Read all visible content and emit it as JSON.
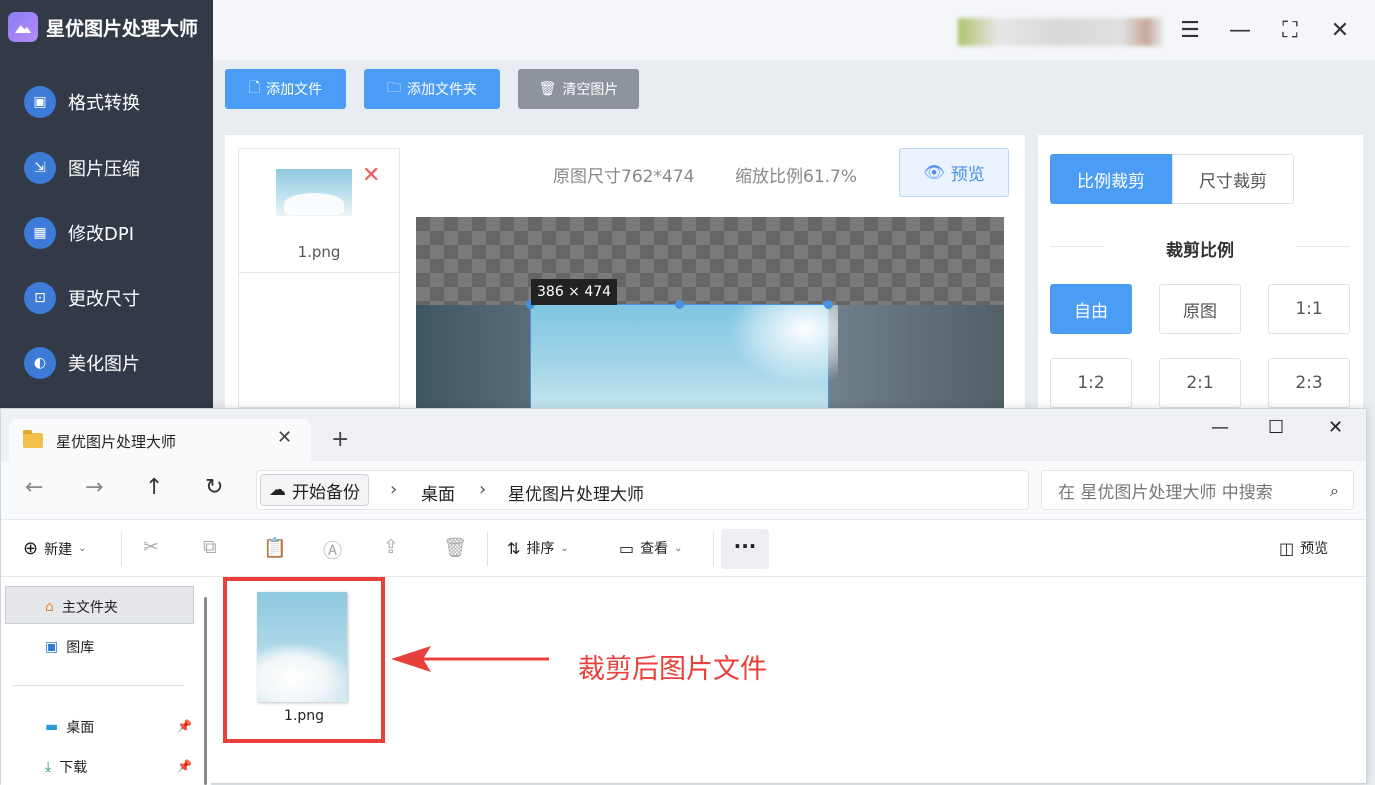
{
  "app": {
    "title": "星优图片处理大师"
  },
  "sidebar": {
    "items": [
      {
        "label": "格式转换",
        "icon": "format-convert-icon"
      },
      {
        "label": "图片压缩",
        "icon": "compress-icon"
      },
      {
        "label": "修改DPI",
        "icon": "dpi-icon"
      },
      {
        "label": "更改尺寸",
        "icon": "resize-icon"
      },
      {
        "label": "美化图片",
        "icon": "beautify-icon"
      }
    ]
  },
  "toolbar": {
    "add_file": "添加文件",
    "add_folder": "添加文件夹",
    "clear": "清空图片"
  },
  "filelist": {
    "items": [
      {
        "name": "1.png"
      }
    ]
  },
  "editor": {
    "original_size": "原图尺寸762*474",
    "zoom": "缩放比例61.7%",
    "preview": "预览",
    "crop_size": "386 × 474"
  },
  "crop": {
    "tabs": [
      "比例裁剪",
      "尺寸裁剪"
    ],
    "active_tab": "比例裁剪",
    "ratio_title": "裁剪比例",
    "ratios": [
      "自由",
      "原图",
      "1:1",
      "1:2",
      "2:1",
      "2:3"
    ],
    "active_ratio": "自由"
  },
  "explorer": {
    "tab_title": "星优图片处理大师",
    "backup": "开始备份",
    "breadcrumb": [
      "桌面",
      "星优图片处理大师"
    ],
    "search_placeholder": "在 星优图片处理大师 中搜索",
    "commands": {
      "new": "新建",
      "sort": "排序",
      "view": "查看",
      "preview": "预览"
    },
    "nav": [
      {
        "label": "主文件夹",
        "icon": "home-icon"
      },
      {
        "label": "图库",
        "icon": "gallery-icon"
      },
      {
        "label": "桌面",
        "icon": "desktop-icon"
      },
      {
        "label": "下载",
        "icon": "download-icon"
      }
    ],
    "files": [
      {
        "name": "1.png"
      }
    ],
    "annotation": "裁剪后图片文件"
  },
  "colors": {
    "accent": "#4b9cf5",
    "sidebar": "#323a48",
    "annotation": "#e8403a"
  }
}
